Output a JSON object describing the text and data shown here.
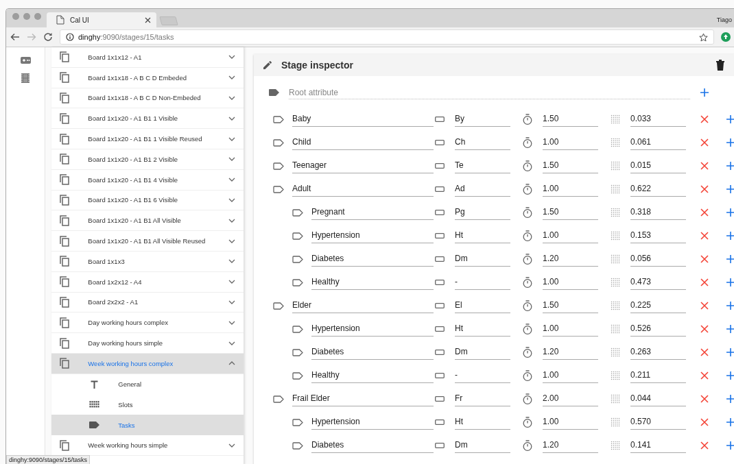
{
  "browser": {
    "tab_title": "Cal UI",
    "profile": "Tiago",
    "address_host": "dinghy",
    "address_path": ":9090/stages/15/tasks",
    "status_url": "dinghy:9090/stages/15/tasks"
  },
  "sidebar": {
    "items": [
      {
        "label": "Board 1x1x12 - A1",
        "expanded": false,
        "selected": false
      },
      {
        "label": "Board 1x1x18 - A B C D Embeded",
        "expanded": false,
        "selected": false
      },
      {
        "label": "Board 1x1x18 - A B C D Non-Embeded",
        "expanded": false,
        "selected": false
      },
      {
        "label": "Board 1x1x20 - A1 B1 1 Visible",
        "expanded": false,
        "selected": false
      },
      {
        "label": "Board 1x1x20 - A1 B1 1 Visible Reused",
        "expanded": false,
        "selected": false
      },
      {
        "label": "Board 1x1x20 - A1 B1 2 Visible",
        "expanded": false,
        "selected": false
      },
      {
        "label": "Board 1x1x20 - A1 B1 4 Visible",
        "expanded": false,
        "selected": false
      },
      {
        "label": "Board 1x1x20 - A1 B1 6 Visible",
        "expanded": false,
        "selected": false
      },
      {
        "label": "Board 1x1x20 - A1 B1 All Visible",
        "expanded": false,
        "selected": false
      },
      {
        "label": "Board 1x1x20 - A1 B1 All Visible Reused",
        "expanded": false,
        "selected": false
      },
      {
        "label": "Board 1x1x3",
        "expanded": false,
        "selected": false
      },
      {
        "label": "Board 1x2x12 - A4",
        "expanded": false,
        "selected": false
      },
      {
        "label": "Board 2x2x2 - A1",
        "expanded": false,
        "selected": false
      },
      {
        "label": "Day working hours complex",
        "expanded": false,
        "selected": false
      },
      {
        "label": "Day working hours simple",
        "expanded": false,
        "selected": false
      },
      {
        "label": "Week working hours complex",
        "expanded": true,
        "selected": true,
        "children": [
          {
            "label": "General",
            "kind": "general",
            "selected": false
          },
          {
            "label": "Slots",
            "kind": "slots",
            "selected": false
          },
          {
            "label": "Tasks",
            "kind": "tasks",
            "selected": true
          }
        ]
      },
      {
        "label": "Week working hours simple",
        "expanded": false,
        "selected": false
      }
    ]
  },
  "inspector": {
    "title": "Stage inspector",
    "root_placeholder": "Root attribute",
    "attributes": [
      {
        "name": "Baby",
        "abbr": "By",
        "duration": "1.50",
        "share": "0.033"
      },
      {
        "name": "Child",
        "abbr": "Ch",
        "duration": "1.00",
        "share": "0.061"
      },
      {
        "name": "Teenager",
        "abbr": "Te",
        "duration": "1.50",
        "share": "0.015"
      },
      {
        "name": "Adult",
        "abbr": "Ad",
        "duration": "1.00",
        "share": "0.622",
        "children": [
          {
            "name": "Pregnant",
            "abbr": "Pg",
            "duration": "1.50",
            "share": "0.318"
          },
          {
            "name": "Hypertension",
            "abbr": "Ht",
            "duration": "1.00",
            "share": "0.153"
          },
          {
            "name": "Diabetes",
            "abbr": "Dm",
            "duration": "1.20",
            "share": "0.056"
          },
          {
            "name": "Healthy",
            "abbr": "-",
            "duration": "1.00",
            "share": "0.473"
          }
        ]
      },
      {
        "name": "Elder",
        "abbr": "El",
        "duration": "1.50",
        "share": "0.225",
        "children": [
          {
            "name": "Hypertension",
            "abbr": "Ht",
            "duration": "1.00",
            "share": "0.526"
          },
          {
            "name": "Diabetes",
            "abbr": "Dm",
            "duration": "1.20",
            "share": "0.263"
          },
          {
            "name": "Healthy",
            "abbr": "-",
            "duration": "1.00",
            "share": "0.211"
          }
        ]
      },
      {
        "name": "Frail Elder",
        "abbr": "Fr",
        "duration": "2.00",
        "share": "0.044",
        "children": [
          {
            "name": "Hypertension",
            "abbr": "Ht",
            "duration": "1.00",
            "share": "0.570"
          },
          {
            "name": "Diabetes",
            "abbr": "Dm",
            "duration": "1.20",
            "share": "0.141"
          }
        ]
      }
    ]
  }
}
